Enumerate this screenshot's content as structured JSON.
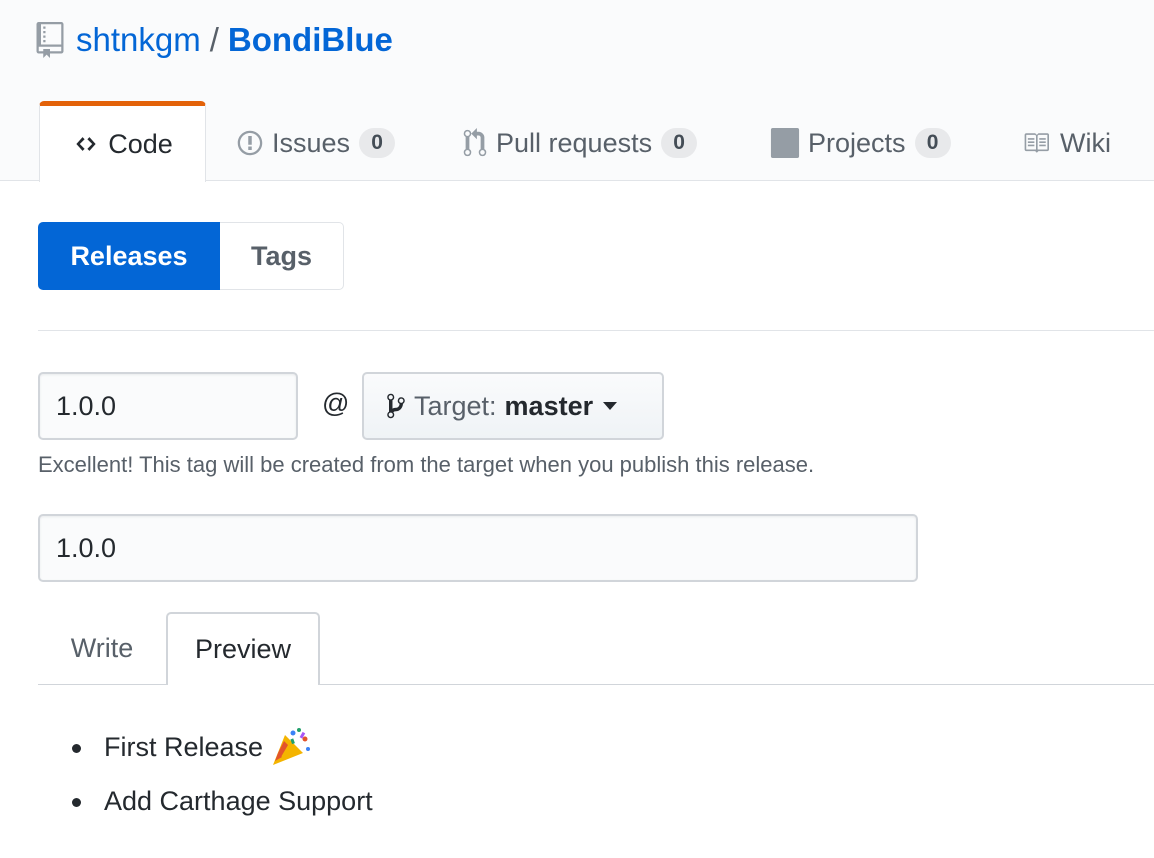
{
  "repo": {
    "owner": "shtnkgm",
    "separator": "/",
    "name": "BondiBlue"
  },
  "tabs": [
    {
      "label": "Code",
      "icon": "code-icon",
      "selected": true
    },
    {
      "label": "Issues",
      "icon": "issue-opened-icon",
      "count": "0"
    },
    {
      "label": "Pull requests",
      "icon": "git-pull-request-icon",
      "count": "0"
    },
    {
      "label": "Projects",
      "icon": "project-icon",
      "count": "0"
    },
    {
      "label": "Wiki",
      "icon": "book-icon"
    }
  ],
  "subnav": {
    "releases": "Releases",
    "tags": "Tags"
  },
  "form": {
    "tag_value": "1.0.0",
    "at": "@",
    "target_label": "Target:",
    "target_branch": "master",
    "hint": "Excellent! This tag will be created from the target when you publish this release.",
    "title_value": "1.0.0"
  },
  "editor_tabs": {
    "write": "Write",
    "preview": "Preview"
  },
  "preview_items": [
    {
      "text": "First Release",
      "emoji": "party-popper-icon"
    },
    {
      "text": "Add Carthage Support"
    }
  ],
  "colors": {
    "accent": "#0366d6",
    "tab_highlight": "#e36209",
    "muted": "#586069"
  }
}
